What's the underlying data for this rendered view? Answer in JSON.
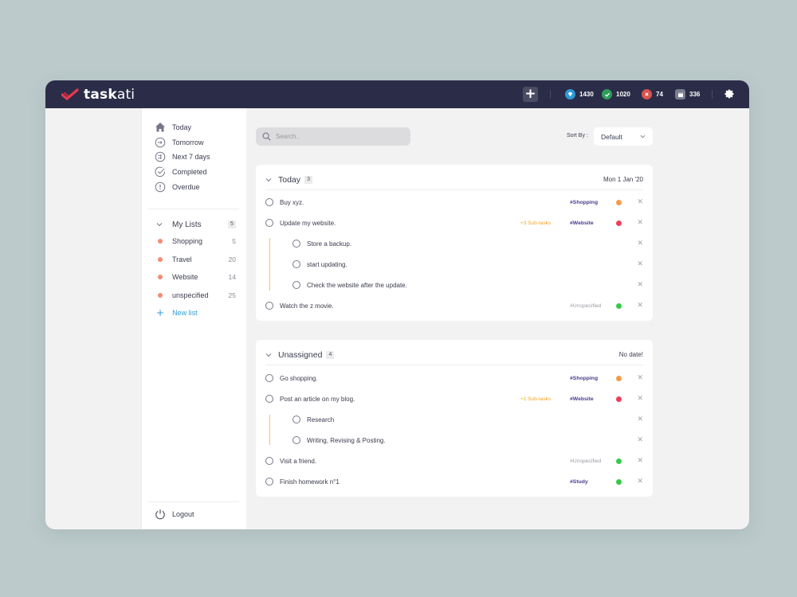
{
  "header": {
    "logo_bold": "task",
    "logo_regular": "ati",
    "add_label": "+",
    "stats": [
      {
        "icon": "diamond-icon",
        "value": "1430",
        "color": "#2e9bd6"
      },
      {
        "icon": "check-icon",
        "value": "1020",
        "color": "#2e9d5c"
      },
      {
        "icon": "cross-icon",
        "value": "74",
        "color": "#d9534f"
      },
      {
        "icon": "calendar-icon",
        "value": "336",
        "color": "#7a7c90"
      }
    ]
  },
  "sidebar": {
    "nav": [
      {
        "label": "Today",
        "icon": "home-icon"
      },
      {
        "label": "Tomorrow",
        "icon": "clock-forward-icon"
      },
      {
        "label": "Next 7 days",
        "icon": "clock-skip-icon"
      },
      {
        "label": "Completed",
        "icon": "check-circle-icon"
      },
      {
        "label": "Overdue",
        "icon": "alert-circle-icon"
      }
    ],
    "my_lists_label": "My Lists",
    "my_lists_count": "5",
    "lists": [
      {
        "label": "Shopping",
        "count": "5"
      },
      {
        "label": "Travel",
        "count": "20"
      },
      {
        "label": "Website",
        "count": "14"
      },
      {
        "label": "unspecified",
        "count": "25"
      }
    ],
    "new_list_label": "New list",
    "logout_label": "Logout"
  },
  "main": {
    "search_placeholder": "Search..",
    "sort_label": "Sort By :",
    "sort_value": "Default",
    "sections": [
      {
        "title": "Today",
        "count": "3",
        "date": "Mon 1 Jan '20",
        "tasks": [
          {
            "text": "Buy xyz.",
            "tag": "#Shopping",
            "priority": "#f59b48"
          },
          {
            "text": "Update my website.",
            "subtasks": "+3 Sub-tasks",
            "tag": "#Website",
            "priority": "#ec3f5c"
          },
          {
            "text": "Store a backup."
          },
          {
            "text": "start updating."
          },
          {
            "text": "Check the website after the update."
          },
          {
            "text": "Watch the z movie.",
            "tag": "#Unspecified",
            "priority": "#33cc47"
          }
        ]
      },
      {
        "title": "Unassigned",
        "count": "4",
        "date": "No date!",
        "tasks": [
          {
            "text": "Go shopping.",
            "tag": "#Shopping",
            "priority": "#f59b48"
          },
          {
            "text": "Post an article on my blog.",
            "subtasks": "+1 Sub-tasks",
            "tag": "#Website",
            "priority": "#ec3f5c"
          },
          {
            "text": "Research"
          },
          {
            "text": "Writing, Revising & Posting."
          },
          {
            "text": "Visit a friend.",
            "tag": "#Unspecified",
            "priority": "#33cc47"
          },
          {
            "text": "Finish homework n°1",
            "tag": "#Study",
            "priority": "#33cc47"
          }
        ]
      }
    ]
  }
}
